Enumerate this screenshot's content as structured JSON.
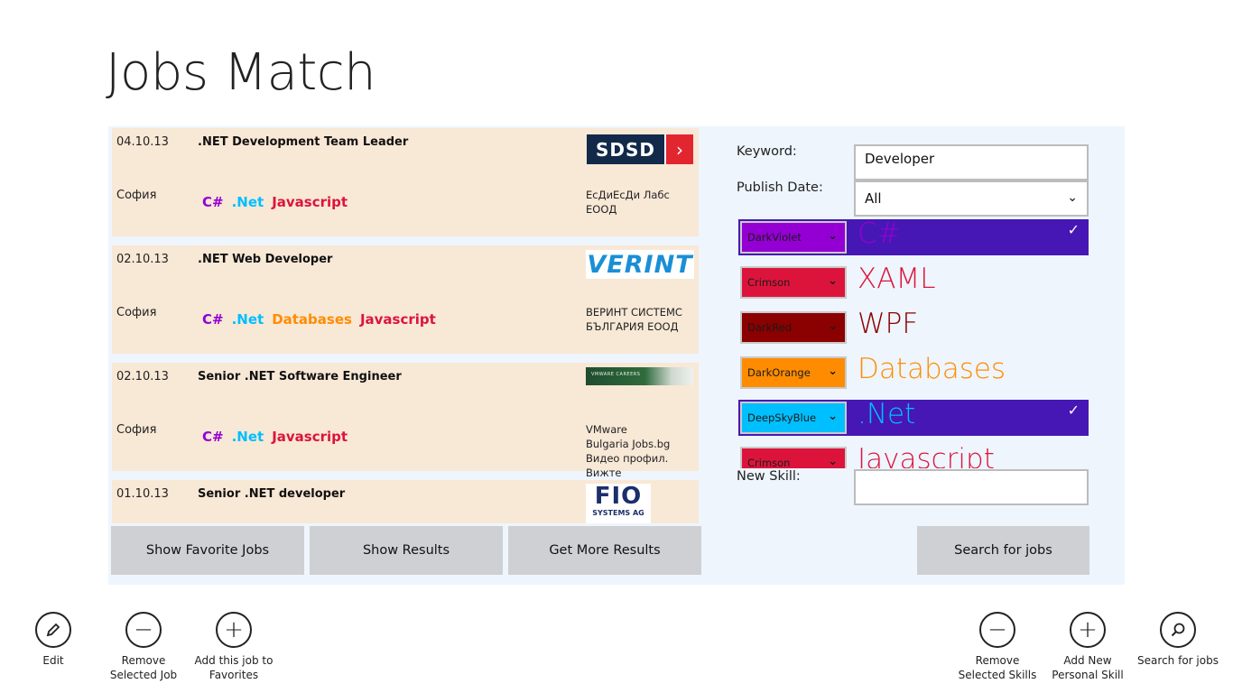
{
  "app": {
    "title": "Jobs Match"
  },
  "jobs": [
    {
      "date": "04.10.13",
      "title": ".NET Development Team Leader",
      "city": "София",
      "skills": [
        {
          "name": "C#",
          "color": "#9400d3"
        },
        {
          "name": ".Net",
          "color": "#00bfff"
        },
        {
          "name": "Javascript",
          "color": "#dc143c"
        }
      ],
      "company": "ЕсДиЕсДи Лабс ЕООД",
      "logo_text": "SDSD"
    },
    {
      "date": "02.10.13",
      "title": ".NET Web Developer",
      "city": "София",
      "skills": [
        {
          "name": "C#",
          "color": "#9400d3"
        },
        {
          "name": ".Net",
          "color": "#00bfff"
        },
        {
          "name": "Databases",
          "color": "#ff8c00"
        },
        {
          "name": "Javascript",
          "color": "#dc143c"
        }
      ],
      "company": "ВЕРИНТ СИСТЕМС БЪЛГАРИЯ ЕООД",
      "logo_text": "VERINT"
    },
    {
      "date": "02.10.13",
      "title": "Senior .NET Software Engineer",
      "city": "София",
      "skills": [
        {
          "name": "C#",
          "color": "#9400d3"
        },
        {
          "name": ".Net",
          "color": "#00bfff"
        },
        {
          "name": "Javascript",
          "color": "#dc143c"
        }
      ],
      "company_lines": [
        "VMware",
        "Bulgaria  Jobs.bg",
        "Видео профил. Вижте"
      ],
      "logo_text": "VMWARE CAREERS"
    },
    {
      "date": "01.10.13",
      "title": "Senior .NET developer",
      "city": "",
      "skills": [],
      "company": "",
      "logo_text": "FIO",
      "logo_sub": "SYSTEMS AG"
    }
  ],
  "buttons": {
    "show_favorite": "Show Favorite Jobs",
    "show_results": "Show Results",
    "get_more": "Get More Results",
    "search": "Search for jobs"
  },
  "search_form": {
    "keyword_label": "Keyword:",
    "keyword_value": "Developer",
    "publish_label": "Publish Date:",
    "publish_value": "All",
    "new_skill_label": "New Skill:",
    "new_skill_value": ""
  },
  "skills": [
    {
      "color_name": "DarkViolet",
      "color": "#9400d3",
      "name": "C#",
      "selected": true
    },
    {
      "color_name": "Crimson",
      "color": "#dc143c",
      "name": "XAML",
      "selected": false
    },
    {
      "color_name": "DarkRed",
      "color": "#8b0000",
      "name": "WPF",
      "selected": false
    },
    {
      "color_name": "DarkOrange",
      "color": "#ff8c00",
      "name": "Databases",
      "selected": false
    },
    {
      "color_name": "DeepSkyBlue",
      "color": "#00bfff",
      "name": ".Net",
      "selected": true
    },
    {
      "color_name": "Crimson",
      "color": "#dc143c",
      "name": "Javascript",
      "selected": false
    }
  ],
  "appbar": {
    "left": [
      {
        "label": "Edit",
        "icon": "pencil-icon"
      },
      {
        "label": "Remove Selected Job",
        "icon": "minus-icon"
      },
      {
        "label": "Add this job to Favorites",
        "icon": "plus-icon"
      }
    ],
    "right": [
      {
        "label": "Remove Selected Skills",
        "icon": "minus-icon"
      },
      {
        "label": "Add New Personal Skill",
        "icon": "plus-icon"
      },
      {
        "label": "Search for jobs",
        "icon": "search-icon"
      }
    ]
  },
  "colors": {
    "selection": "#4617b4",
    "job_bg": "#f8e8d6",
    "panel_bg": "#eef5fd",
    "button_bg": "#cfd0d4"
  }
}
